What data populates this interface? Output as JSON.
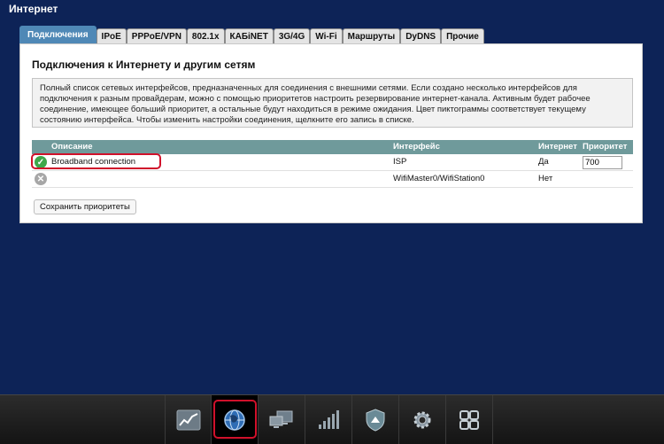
{
  "page": {
    "title": "Интернет"
  },
  "tabs": [
    {
      "label": "Подключения",
      "active": true
    },
    {
      "label": "IPoE"
    },
    {
      "label": "PPPoE/VPN"
    },
    {
      "label": "802.1x"
    },
    {
      "label": "КАБiNET"
    },
    {
      "label": "3G/4G"
    },
    {
      "label": "Wi-Fi"
    },
    {
      "label": "Маршруты"
    },
    {
      "label": "DyDNS"
    },
    {
      "label": "Прочие"
    }
  ],
  "panel": {
    "title": "Подключения к Интернету и другим сетям",
    "info": "Полный список сетевых интерфейсов, предназначенных для соединения с внешними сетями. Если создано несколько интерфейсов для подключения к разным провайдерам, можно с помощью приоритетов настроить резервирование интернет-канала. Активным будет рабочее соединение, имеющее больший приоритет, а остальные будут находиться в режиме ожидания. Цвет пиктограммы соответствует текущему состоянию интерфейса. Чтобы изменить настройки соединения, щелкните его запись в списке."
  },
  "table": {
    "headers": {
      "description": "Описание",
      "interface": "Интерфейс",
      "internet": "Интернет",
      "priority": "Приоритет"
    },
    "rows": [
      {
        "status": "connected",
        "description": "Broadband connection",
        "interface": "ISP",
        "internet": "Да",
        "priority": "700"
      },
      {
        "status": "disconnected",
        "description": "",
        "interface": "WifiMaster0/WifiStation0",
        "internet": "Нет",
        "priority": ""
      }
    ]
  },
  "save_button": "Сохранить приоритеты",
  "taskbar": [
    {
      "icon": "chart-icon"
    },
    {
      "icon": "globe-icon",
      "active": true
    },
    {
      "icon": "network-computers-icon"
    },
    {
      "icon": "signal-bars-icon"
    },
    {
      "icon": "shield-icon"
    },
    {
      "icon": "gear-icon"
    },
    {
      "icon": "apps-grid-icon"
    }
  ],
  "colors": {
    "background": "#0d2357",
    "tab_active": "#4f88b6",
    "table_header": "#6f9a9b",
    "highlight": "#d0112b"
  }
}
